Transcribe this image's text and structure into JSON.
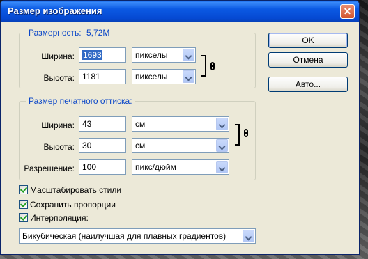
{
  "window": {
    "title": "Размер изображения",
    "close_label": "✕"
  },
  "pixel_dims": {
    "legend": "Размерность:",
    "size": "5,72M",
    "width_label": "Ширина:",
    "width_value": "1693",
    "width_unit": "пикселы",
    "height_label": "Высота:",
    "height_value": "1181",
    "height_unit": "пикселы"
  },
  "doc_size": {
    "legend": "Размер печатного оттиска:",
    "width_label": "Ширина:",
    "width_value": "43",
    "width_unit": "см",
    "height_label": "Высота:",
    "height_value": "30",
    "height_unit": "см",
    "res_label": "Разрешение:",
    "res_value": "100",
    "res_unit": "пикс/дюйм"
  },
  "options": {
    "scale_styles": {
      "label": "Масштабировать стили",
      "checked": true
    },
    "constrain": {
      "label": "Сохранить пропорции",
      "checked": true
    },
    "resample": {
      "label": "Интерполяция:",
      "checked": true
    },
    "method": "Бикубическая (наилучшая для плавных градиентов)"
  },
  "buttons": {
    "ok": "OK",
    "cancel": "Отмена",
    "auto": "Авто..."
  }
}
